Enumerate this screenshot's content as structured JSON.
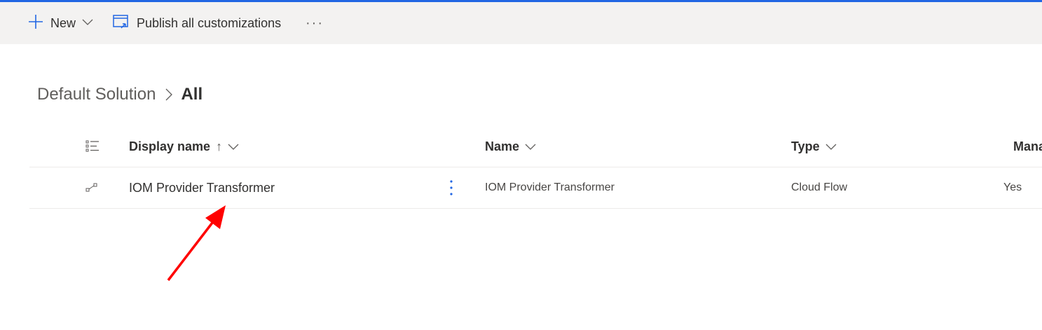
{
  "command_bar": {
    "new_label": "New",
    "publish_label": "Publish all customizations",
    "more_label": "···"
  },
  "breadcrumb": {
    "parent": "Default Solution",
    "current": "All"
  },
  "grid": {
    "columns": [
      {
        "label": "Display name",
        "sort": "ascending"
      },
      {
        "label": "Name"
      },
      {
        "label": "Type"
      },
      {
        "label": "Mana"
      }
    ],
    "sort_arrow": "↑",
    "rows": [
      {
        "display_name": "IOM Provider Transformer",
        "name": "IOM Provider Transformer",
        "type": "Cloud Flow",
        "managed": "Yes"
      }
    ]
  },
  "colors": {
    "accent": "#2266e3",
    "command_bar_bg": "#f3f2f1",
    "annotation_arrow": "#ff0000"
  }
}
